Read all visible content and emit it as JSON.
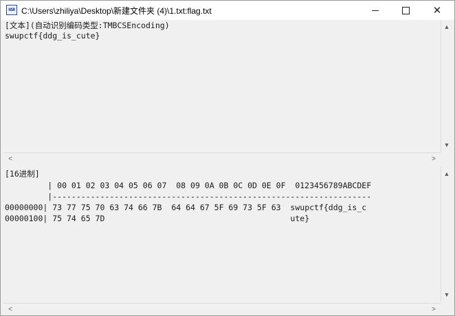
{
  "window": {
    "title": "C:\\Users\\zhiliya\\Desktop\\新建文件夹 (4)\\1.txt:flag.txt",
    "icon_text": "NSR",
    "controls": [
      "minimize-icon",
      "maximize-icon",
      "close-icon"
    ]
  },
  "text_pane": {
    "header": "[文本](自动识别编码类型:TMBCSEncoding)",
    "content": "swupctf{ddg_is_cute}"
  },
  "hex_pane": {
    "header": "[16进制]",
    "column_header": "         | 00 01 02 03 04 05 06 07  08 09 0A 0B 0C 0D 0E 0F  0123456789ABCDEF",
    "separator": "         |-------------------------------------------------------------------",
    "rows": [
      {
        "offset": "00000000",
        "bytes": "| 73 77 75 70 63 74 66 7B  64 64 67 5F 69 73 5F 63  ",
        "ascii": "swupctf{ddg_is_c"
      },
      {
        "offset": "00000100",
        "bytes": "| 75 74 65 7D                                       ",
        "ascii": "ute}"
      }
    ]
  },
  "scroll_arrows": {
    "up": "▲",
    "down": "▼",
    "left": "<",
    "right": ">"
  },
  "colors": {
    "pane_bg": "#f0f0f0",
    "titlebar_bg": "#ffffff",
    "text": "#1a1a1a"
  }
}
